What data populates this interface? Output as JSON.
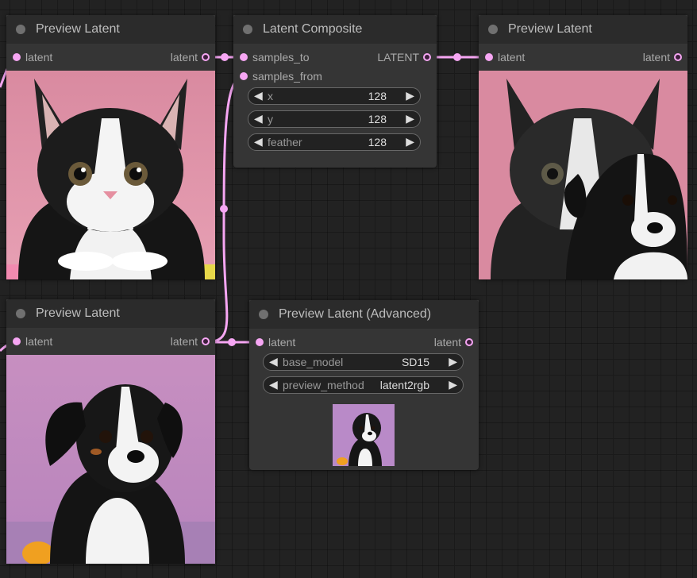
{
  "colors": {
    "latent_link": "#f6a6f3",
    "node_bg": "#353535",
    "node_header": "#2b2b2b",
    "canvas": "#222222"
  },
  "nodes": {
    "preview1": {
      "title": "Preview Latent",
      "input": "latent",
      "output": "latent",
      "image": "kitten"
    },
    "composite": {
      "title": "Latent Composite",
      "input_to": "samples_to",
      "input_from": "samples_from",
      "output": "LATENT",
      "widgets": {
        "x": {
          "label": "x",
          "value": "128"
        },
        "y": {
          "label": "y",
          "value": "128"
        },
        "feather": {
          "label": "feather",
          "value": "128"
        }
      }
    },
    "preview3": {
      "title": "Preview Latent",
      "input": "latent",
      "output": "latent",
      "image": "kitten-with-puppy"
    },
    "preview2": {
      "title": "Preview Latent",
      "input": "latent",
      "output": "latent",
      "image": "puppy"
    },
    "advanced": {
      "title": "Preview Latent (Advanced)",
      "input": "latent",
      "output": "latent",
      "widgets": {
        "base_model": {
          "label": "base_model",
          "value": "SD15"
        },
        "preview_method": {
          "label": "preview_method",
          "value": "latent2rgb"
        }
      },
      "image": "puppy-thumbnail"
    }
  },
  "icons": {
    "arrow_left": "◀",
    "arrow_right": "▶",
    "status": "node-dot-icon"
  }
}
